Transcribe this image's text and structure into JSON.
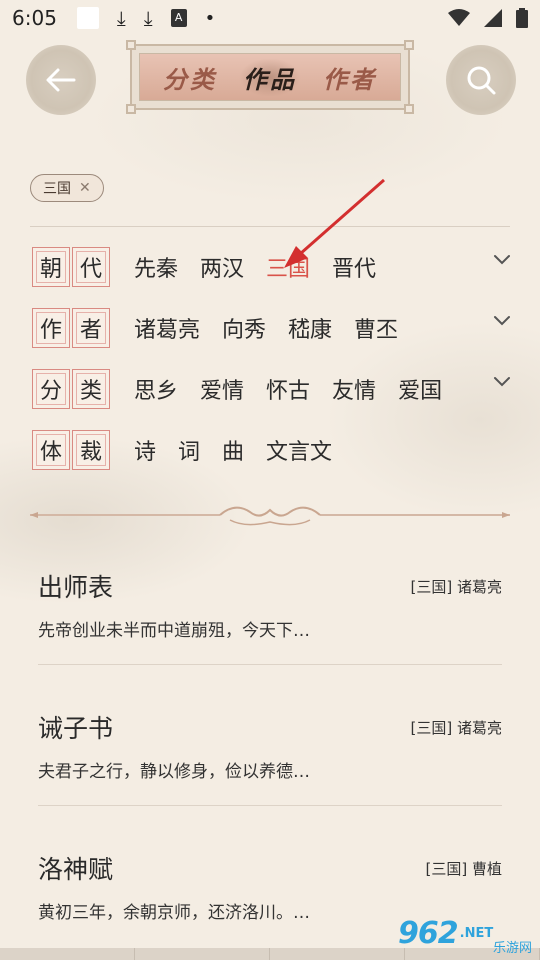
{
  "status_bar": {
    "time": "6:05"
  },
  "header": {
    "tabs": [
      {
        "label": "分类",
        "active": false
      },
      {
        "label": "作品",
        "active": true
      },
      {
        "label": "作者",
        "active": false
      }
    ]
  },
  "selected_filter": {
    "label": "三国",
    "close": "✕"
  },
  "filters": [
    {
      "label_chars": [
        "朝",
        "代"
      ],
      "options": [
        "先秦",
        "两汉",
        "三国",
        "晋代"
      ],
      "selected": "三国",
      "expandable": true
    },
    {
      "label_chars": [
        "作",
        "者"
      ],
      "options": [
        "诸葛亮",
        "向秀",
        "嵇康",
        "曹丕"
      ],
      "selected": null,
      "expandable": true
    },
    {
      "label_chars": [
        "分",
        "类"
      ],
      "options": [
        "思乡",
        "爱情",
        "怀古",
        "友情",
        "爱国"
      ],
      "selected": null,
      "expandable": true
    },
    {
      "label_chars": [
        "体",
        "裁"
      ],
      "options": [
        "诗",
        "词",
        "曲",
        "文言文"
      ],
      "selected": null,
      "expandable": false
    }
  ],
  "works": [
    {
      "title": "出师表",
      "meta": "[三国] 诸葛亮",
      "excerpt": "先帝创业未半而中道崩殂，今天下…"
    },
    {
      "title": "诫子书",
      "meta": "[三国] 诸葛亮",
      "excerpt": "夫君子之行，静以修身，俭以养德…"
    },
    {
      "title": "洛神赋",
      "meta": "[三国] 曹植",
      "excerpt": "黄初三年，余朝京师，还济洛川。…"
    }
  ],
  "watermark": {
    "logo": "962",
    "suffix": ".NET",
    "sub": "乐游网"
  },
  "colors": {
    "background": "#f4ede3",
    "selected_option": "#d9534a",
    "label_border": "#d98a82",
    "annotation_arrow": "#d32f2f"
  },
  "icons": {
    "back": "arrow-left-icon",
    "search": "search-icon",
    "chevron": "chevron-down-icon"
  }
}
